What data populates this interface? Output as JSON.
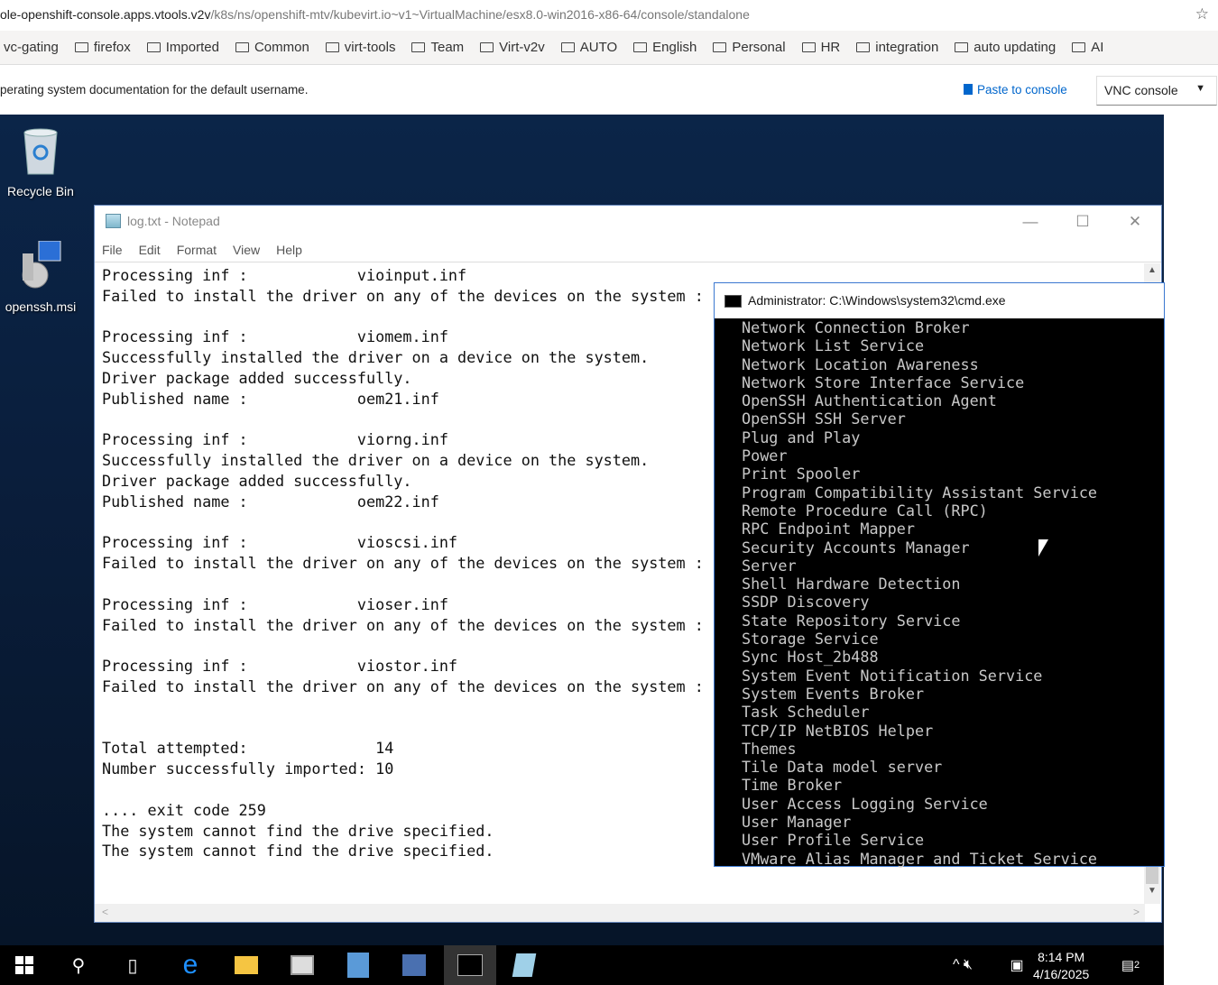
{
  "browser": {
    "url_host": "ole-openshift-console.apps.vtools.v2v",
    "url_path": "/k8s/ns/openshift-mtv/kubevirt.io~v1~VirtualMachine/esx8.0-win2016-x86-64/console/standalone",
    "bookmarks": [
      "vc-gating",
      "firefox",
      "Imported",
      "Common",
      "virt-tools",
      "Team",
      "Virt-v2v",
      "AUTO",
      "English",
      "Personal",
      "HR",
      "integration",
      "auto updating",
      "AI"
    ]
  },
  "console": {
    "message": "perating system documentation for the default username.",
    "paste_label": "Paste to console",
    "type_select": "VNC console"
  },
  "desktop": {
    "icons": [
      "Recycle Bin",
      "openssh.msi"
    ]
  },
  "notepad": {
    "title": "log.txt - Notepad",
    "menu": [
      "File",
      "Edit",
      "Format",
      "View",
      "Help"
    ],
    "lines": [
      "Processing inf :            vioinput.inf",
      "Failed to install the driver on any of the devices on the system :",
      "",
      "Processing inf :            viomem.inf",
      "Successfully installed the driver on a device on the system.",
      "Driver package added successfully.",
      "Published name :            oem21.inf",
      "",
      "Processing inf :            viorng.inf",
      "Successfully installed the driver on a device on the system.",
      "Driver package added successfully.",
      "Published name :            oem22.inf",
      "",
      "Processing inf :            vioscsi.inf",
      "Failed to install the driver on any of the devices on the system :",
      "",
      "Processing inf :            vioser.inf",
      "Failed to install the driver on any of the devices on the system :",
      "",
      "Processing inf :            viostor.inf",
      "Failed to install the driver on any of the devices on the system :",
      "",
      "",
      "Total attempted:              14",
      "Number successfully imported: 10",
      "",
      ".... exit code 259",
      "The system cannot find the drive specified.",
      "The system cannot find the drive specified."
    ]
  },
  "cmd": {
    "title": "Administrator: C:\\Windows\\system32\\cmd.exe",
    "lines": [
      "Network Connection Broker",
      "Network List Service",
      "Network Location Awareness",
      "Network Store Interface Service",
      "OpenSSH Authentication Agent",
      "OpenSSH SSH Server",
      "Plug and Play",
      "Power",
      "Print Spooler",
      "Program Compatibility Assistant Service",
      "Remote Procedure Call (RPC)",
      "RPC Endpoint Mapper",
      "Security Accounts Manager",
      "Server",
      "Shell Hardware Detection",
      "SSDP Discovery",
      "State Repository Service",
      "Storage Service",
      "Sync Host_2b488",
      "System Event Notification Service",
      "System Events Broker",
      "Task Scheduler",
      "TCP/IP NetBIOS Helper",
      "Themes",
      "Tile Data model server",
      "Time Broker",
      "User Access Logging Service",
      "User Manager",
      "User Profile Service",
      "VMware Alias Manager and Ticket Service"
    ]
  },
  "taskbar": {
    "time": "8:14 PM",
    "date": "4/16/2025",
    "notifications": "2"
  }
}
